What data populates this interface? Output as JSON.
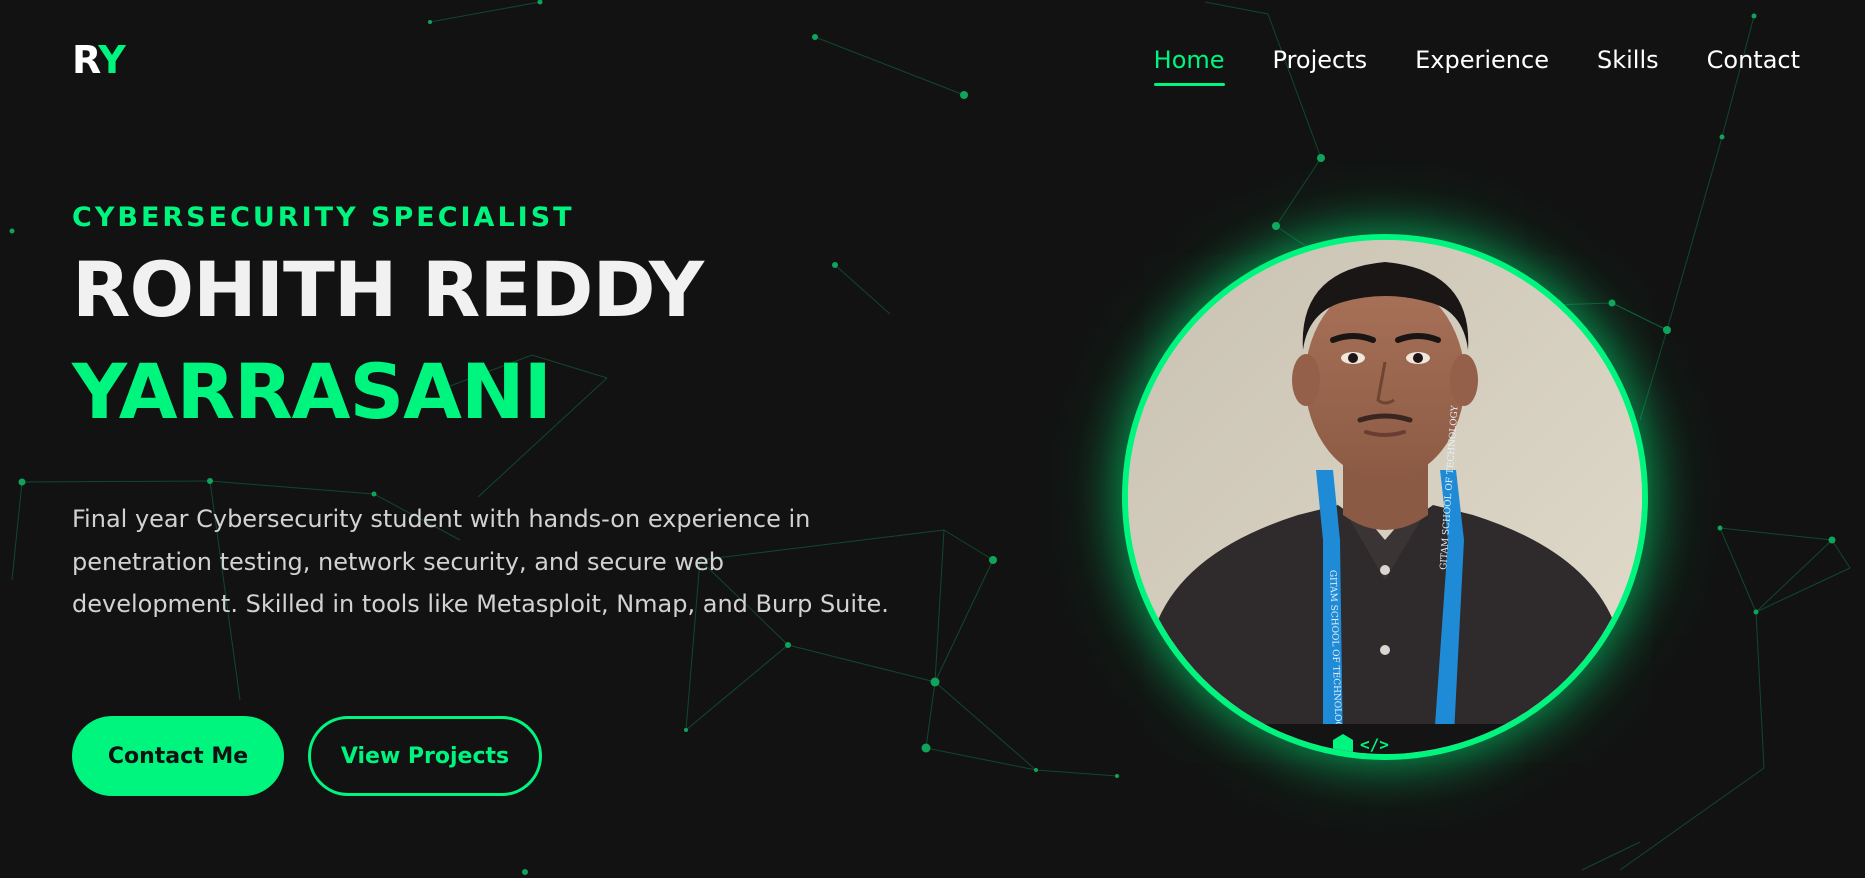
{
  "logo": {
    "part1": "R",
    "part2": "Y"
  },
  "nav": {
    "items": [
      {
        "label": "Home",
        "active": true
      },
      {
        "label": "Projects",
        "active": false
      },
      {
        "label": "Experience",
        "active": false
      },
      {
        "label": "Skills",
        "active": false
      },
      {
        "label": "Contact",
        "active": false
      }
    ]
  },
  "hero": {
    "eyebrow": "CYBERSECURITY SPECIALIST",
    "first_name": "ROHITH REDDY",
    "last_name": "YARRASANI",
    "intro": "Final year Cybersecurity student with hands-on experience in penetration testing, network security, and secure web development. Skilled in tools like Metasploit, Nmap, and Burp Suite.",
    "primary_button": "Contact Me",
    "secondary_button": "View Projects"
  },
  "portrait": {
    "lanyard_text": "GITAM SCHOOL OF TECHNOLOGY"
  },
  "colors": {
    "background": "#121212",
    "accent": "#00f57e",
    "text": "#ffffff",
    "muted_text": "#d2d2d2"
  }
}
